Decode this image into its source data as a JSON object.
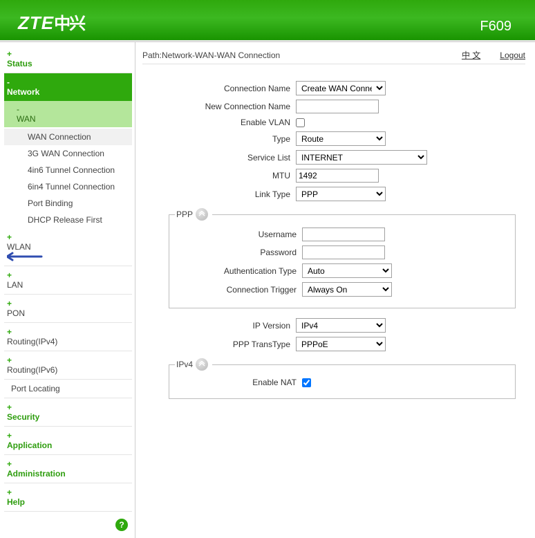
{
  "brand": {
    "en": "ZTE",
    "cn": "中兴",
    "model": "F609"
  },
  "topbar": {
    "path": "Path:Network-WAN-WAN Connection",
    "lang": "中 文",
    "logout": "Logout"
  },
  "sidebar": {
    "status": "Status",
    "network": "Network",
    "wan": "WAN",
    "wan_items": {
      "wan_conn": "WAN Connection",
      "wan_3g": "3G WAN Connection",
      "tun_4in6": "4in6 Tunnel Connection",
      "tun_6in4": "6in4 Tunnel Connection",
      "port_bind": "Port Binding",
      "dhcp_rel": "DHCP Release First"
    },
    "wlan": "WLAN",
    "lan": "LAN",
    "pon": "PON",
    "routing4": "Routing(IPv4)",
    "routing6": "Routing(IPv6)",
    "port_loc": "Port Locating",
    "security": "Security",
    "application": "Application",
    "administration": "Administration",
    "help": "Help",
    "help_icon": "?"
  },
  "form": {
    "labels": {
      "conn_name": "Connection Name",
      "new_conn": "New Connection Name",
      "enable_vlan": "Enable VLAN",
      "type": "Type",
      "service_list": "Service List",
      "mtu": "MTU",
      "link_type": "Link Type",
      "username": "Username",
      "password": "Password",
      "auth_type": "Authentication Type",
      "conn_trigger": "Connection Trigger",
      "ip_version": "IP Version",
      "ppp_transtype": "PPP TransType",
      "enable_nat": "Enable NAT"
    },
    "values": {
      "conn_name": "Create WAN Connection",
      "new_conn": "",
      "enable_vlan": false,
      "type": "Route",
      "service_list": "INTERNET",
      "mtu": "1492",
      "link_type": "PPP",
      "username": "",
      "password": "",
      "auth_type": "Auto",
      "conn_trigger": "Always On",
      "ip_version": "IPv4",
      "ppp_transtype": "PPPoE",
      "enable_nat": true
    },
    "groups": {
      "ppp": "PPP",
      "ipv4": "IPv4"
    }
  }
}
